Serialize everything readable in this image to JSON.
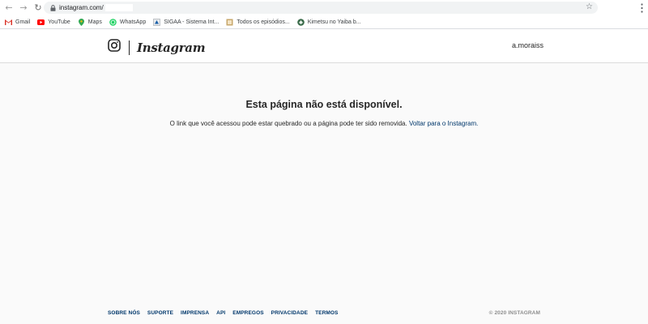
{
  "browser": {
    "url": "instagram.com/",
    "bookmarks": [
      {
        "label": "Gmail",
        "icon": "gmail-icon"
      },
      {
        "label": "YouTube",
        "icon": "youtube-icon"
      },
      {
        "label": "Maps",
        "icon": "maps-icon"
      },
      {
        "label": "WhatsApp",
        "icon": "whatsapp-icon"
      },
      {
        "label": "SIGAA - Sistema Int...",
        "icon": "sigaa-icon"
      },
      {
        "label": "Todos os episódios...",
        "icon": "page-icon"
      },
      {
        "label": "Kimetsu no Yaiba b...",
        "icon": "anime-icon"
      }
    ]
  },
  "header": {
    "wordmark": "Instagram",
    "username": "a.moraiss"
  },
  "main": {
    "title": "Esta página não está disponível.",
    "message": "O link que você acessou pode estar quebrado ou a página pode ter sido removida. ",
    "back_link": "Voltar para o Instagram."
  },
  "footer": {
    "links": [
      "SOBRE NÓS",
      "SUPORTE",
      "IMPRENSA",
      "API",
      "EMPREGOS",
      "PRIVACIDADE",
      "TERMOS"
    ],
    "copyright": "© 2020 INSTAGRAM"
  },
  "colors": {
    "link": "#00376b",
    "text": "#262626",
    "background": "#fafafa",
    "muted": "#8e8e8e"
  }
}
